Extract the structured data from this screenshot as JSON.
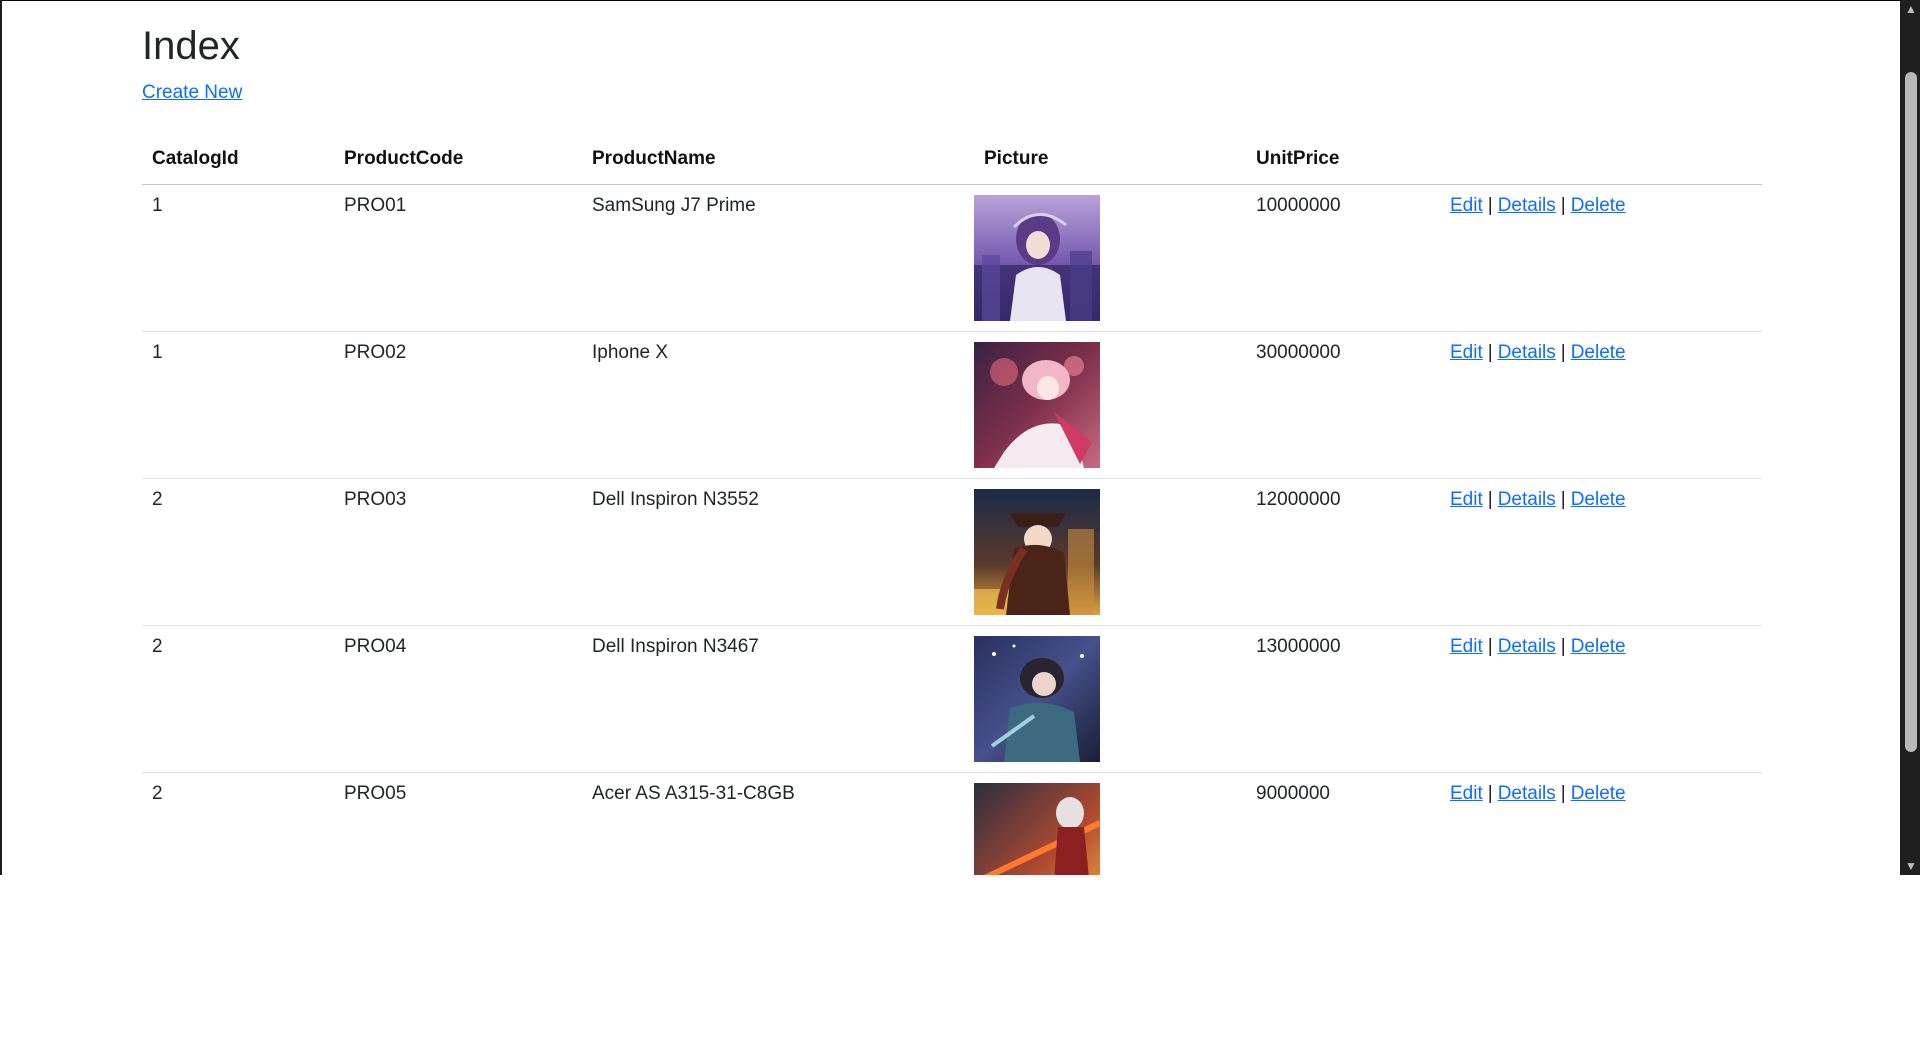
{
  "page": {
    "title": "Index",
    "create_link": "Create New"
  },
  "table": {
    "headers": [
      "CatalogId",
      "ProductCode",
      "ProductName",
      "Picture",
      "UnitPrice",
      ""
    ],
    "rows": [
      {
        "catalog_id": "1",
        "code": "PRO01",
        "name": "SamSung J7 Prime",
        "price": "10000000",
        "picture": "anime-art-1"
      },
      {
        "catalog_id": "1",
        "code": "PRO02",
        "name": "Iphone X",
        "price": "30000000",
        "picture": "anime-art-2"
      },
      {
        "catalog_id": "2",
        "code": "PRO03",
        "name": "Dell Inspiron N3552",
        "price": "12000000",
        "picture": "anime-art-3"
      },
      {
        "catalog_id": "2",
        "code": "PRO04",
        "name": "Dell Inspiron N3467",
        "price": "13000000",
        "picture": "anime-art-4"
      },
      {
        "catalog_id": "2",
        "code": "PRO05",
        "name": "Acer AS A315-31-C8GB",
        "price": "9000000",
        "picture": "anime-art-5"
      }
    ],
    "actions": {
      "edit": "Edit",
      "details": "Details",
      "delete": "Delete",
      "separator": "|"
    }
  },
  "colors": {
    "link": "#0d6efd",
    "text": "#212529",
    "scrollbar": "#1f1f1f"
  }
}
